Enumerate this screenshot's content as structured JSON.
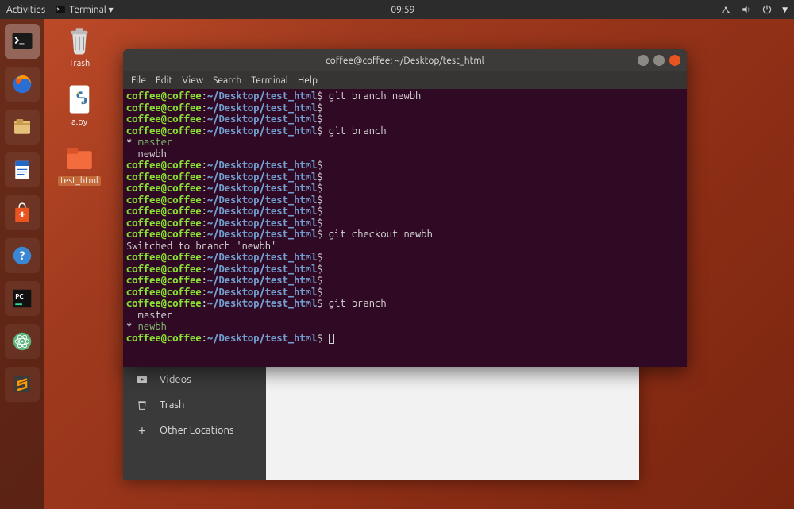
{
  "topbar": {
    "activities": "Activities",
    "app_indicator": "Terminal ▾",
    "clock": "— 09:59"
  },
  "desktop": {
    "trash_label": "Trash",
    "apy_label": "a.py",
    "folder_label": "test_html"
  },
  "files_window": {
    "sidebar": {
      "videos": "Videos",
      "trash": "Trash",
      "other": "Other Locations"
    }
  },
  "terminal": {
    "title": "coffee@coffee: ~/Desktop/test_html",
    "menubar": [
      "File",
      "Edit",
      "View",
      "Search",
      "Terminal",
      "Help"
    ],
    "prompt": {
      "userhost": "coffee@coffee",
      "sep": ":",
      "path": "~/Desktop/test_html",
      "sigil": "$"
    },
    "lines": [
      {
        "cmd": "git branch newbh"
      },
      {
        "cmd": ""
      },
      {
        "cmd": ""
      },
      {
        "cmd": "git branch"
      },
      {
        "out_star": "* ",
        "out_branch_active": "master"
      },
      {
        "out_plain": "  newbh"
      },
      {
        "cmd": ""
      },
      {
        "cmd": ""
      },
      {
        "cmd": ""
      },
      {
        "cmd": ""
      },
      {
        "cmd": ""
      },
      {
        "cmd": ""
      },
      {
        "cmd": "git checkout newbh"
      },
      {
        "out_plain": "Switched to branch 'newbh'"
      },
      {
        "cmd": ""
      },
      {
        "cmd": ""
      },
      {
        "cmd": ""
      },
      {
        "cmd": ""
      },
      {
        "cmd": "git branch"
      },
      {
        "out_plain": "  master"
      },
      {
        "out_star": "* ",
        "out_branch_active": "newbh"
      },
      {
        "cmd": "",
        "cursor": true
      }
    ]
  }
}
